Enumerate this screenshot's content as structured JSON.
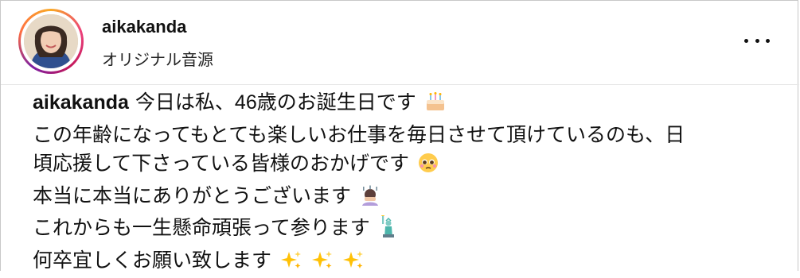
{
  "post": {
    "username": "aikakanda",
    "audio_label": "オリジナル音源",
    "more_icon": "more-horizontal-icon"
  },
  "caption": {
    "author": "aikakanda",
    "lines": [
      "今日は私、46歳のお誕生日です",
      "この年齢になってもとても楽しいお仕事を毎日させて頂けているのも、日",
      "頃応援して下さっている皆様のおかげです",
      "本当に本当にありがとうございます",
      "これからも一生懸命頑張って参ります",
      "何卒宜しくお願い致します"
    ],
    "emojis": {
      "line0": "birthday-cake-icon",
      "line2": "pleading-face-icon",
      "line3": "person-bowing-icon",
      "line4": "statue-of-liberty-icon",
      "line5": [
        "sparkles-icon",
        "sparkles-icon",
        "sparkles-icon"
      ]
    }
  }
}
